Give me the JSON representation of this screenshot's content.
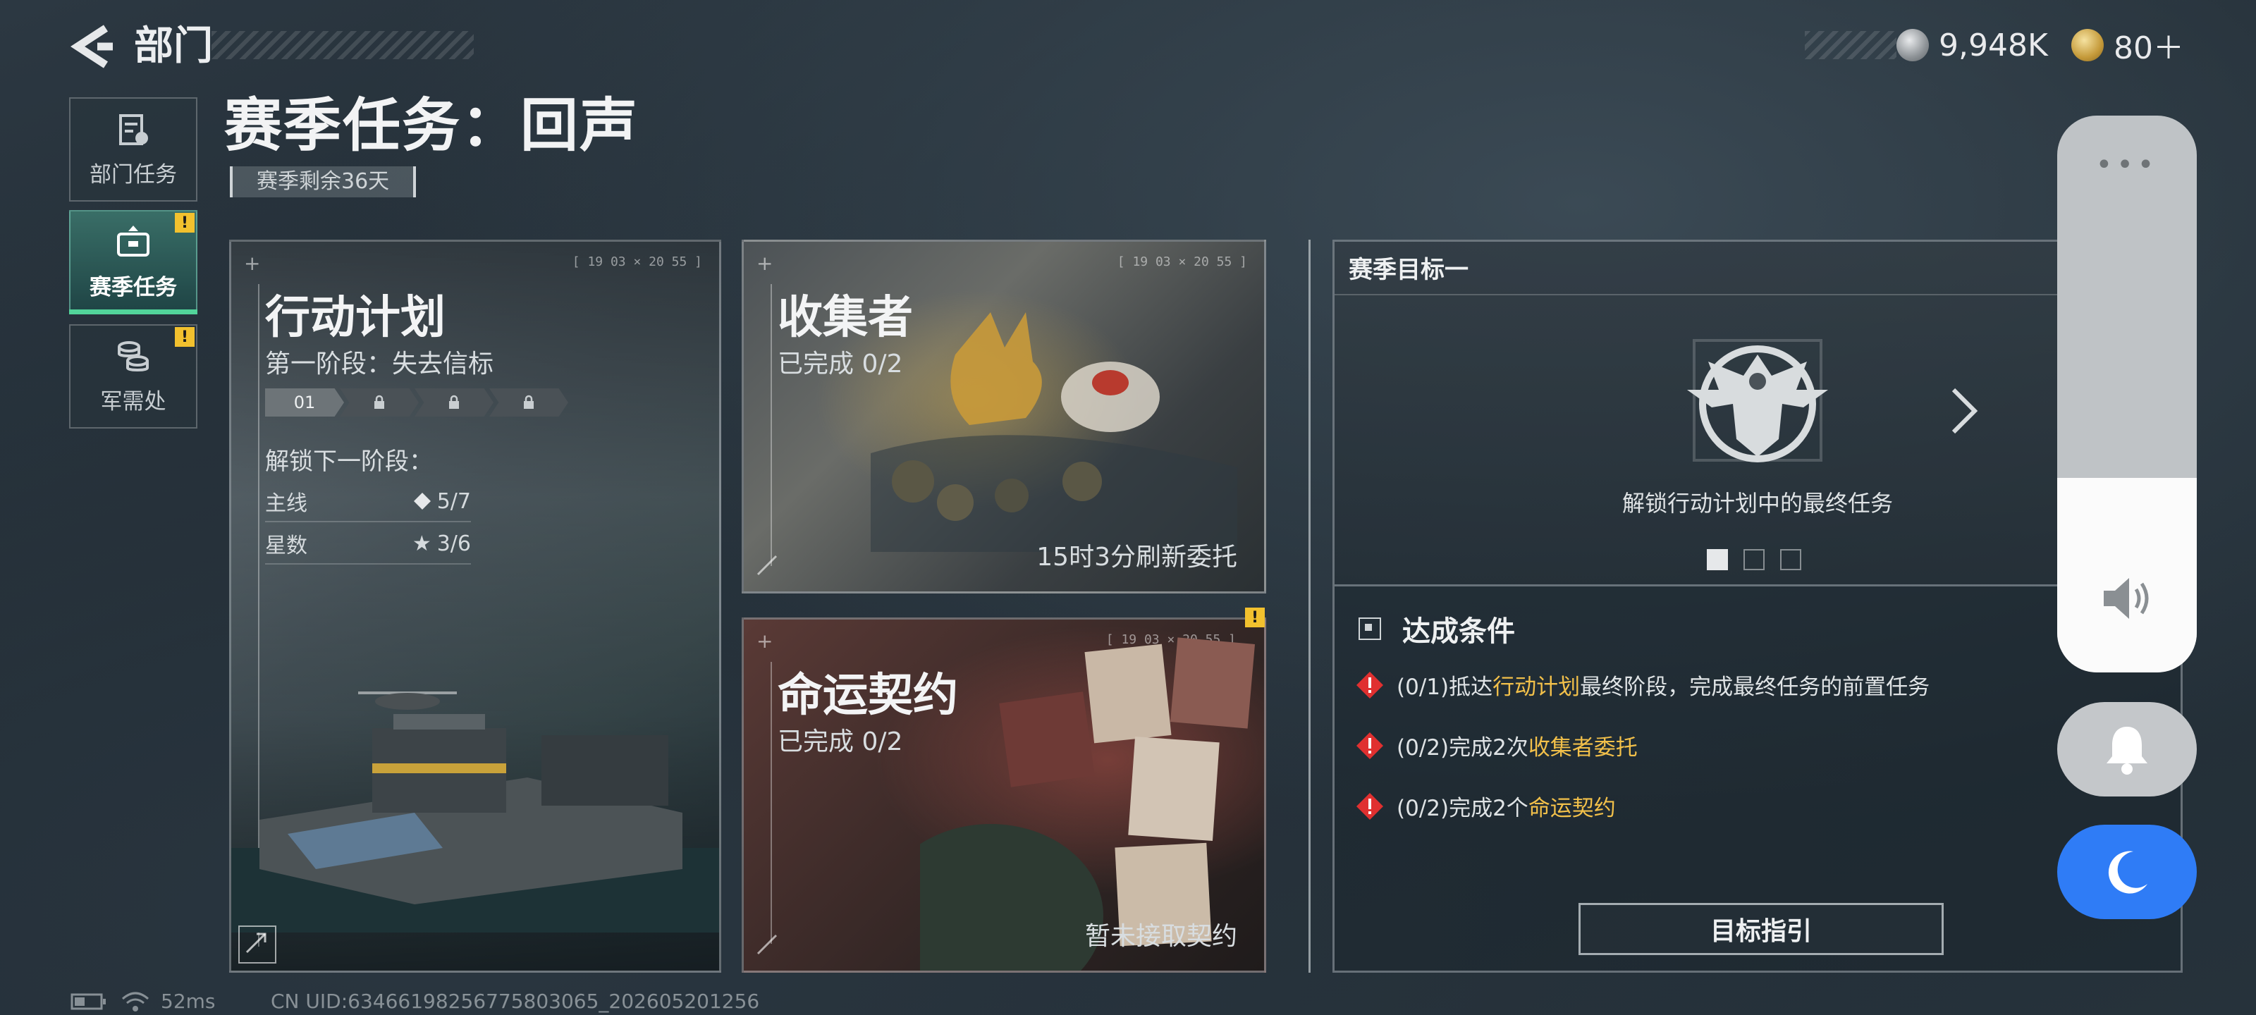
{
  "header": {
    "back_icon": "back-arrow-icon",
    "title": "部门",
    "silver_icon": "silver-coin-icon",
    "silver_amount": "9,948K",
    "gold_icon": "gold-coin-icon",
    "gold_amount": "80＋"
  },
  "sidebar": {
    "items": [
      {
        "label": "部门任务",
        "icon": "task-clipboard-icon",
        "active": false,
        "alert": false
      },
      {
        "label": "赛季任务",
        "icon": "briefcase-icon",
        "active": true,
        "alert": true
      },
      {
        "label": "军需处",
        "icon": "coins-stack-icon",
        "active": false,
        "alert": true
      }
    ],
    "alert_symbol": "!"
  },
  "page": {
    "title": "赛季任务：回声",
    "season_remaining": "赛季剩余36天"
  },
  "cards": {
    "operation": {
      "title": "行动计划",
      "stage": "第一阶段：失去信标",
      "stage_steps": [
        "01",
        "lock",
        "lock",
        "lock"
      ],
      "unlock_label": "解锁下一阶段：",
      "main_label": "主线",
      "main_value": "5/7",
      "star_label": "星数",
      "star_value": "3/6",
      "corner_text": "[ 19 03 × 20 55 ]"
    },
    "collector": {
      "title": "收集者",
      "progress": "已完成 0/2",
      "refresh": "15时3分刷新委托",
      "corner_text": "[ 19 03 × 20 55 ]"
    },
    "fate": {
      "title": "命运契约",
      "progress": "已完成 0/2",
      "status": "暂未接取契约",
      "corner_text": "[ 19 03 × 20 55 ]",
      "alert": "!"
    }
  },
  "goal_panel": {
    "header": "赛季目标一",
    "emblem_icon": "eagle-emblem-icon",
    "description": "解锁行动计划中的最终任务",
    "page_indicator": {
      "current": 1,
      "total": 3
    },
    "conditions_title": "达成条件",
    "conditions": [
      {
        "prefix": "(0/1)抵达",
        "highlight": "行动计划",
        "suffix": "最终阶段，完成最终任务的前置任务"
      },
      {
        "prefix": "(0/2)完成2次",
        "highlight": "收集者委托",
        "suffix": ""
      },
      {
        "prefix": "(0/2)完成2个",
        "highlight": "命运契约",
        "suffix": ""
      }
    ],
    "guide_button": "目标指引",
    "colors": {
      "highlight": "#f2c04a",
      "warning": "#e03030"
    }
  },
  "system_overlay": {
    "volume_level": 0.35,
    "more_icon": "more-dots-icon",
    "speaker_icon": "speaker-icon",
    "bell_icon": "bell-icon",
    "moon_icon": "moon-icon",
    "dnd_color": "#2f7cf6"
  },
  "footer": {
    "battery_icon": "battery-icon",
    "wifi_icon": "wifi-icon",
    "ping": "52ms",
    "uid": "CN UID:63466198256775803065_202605201256"
  }
}
